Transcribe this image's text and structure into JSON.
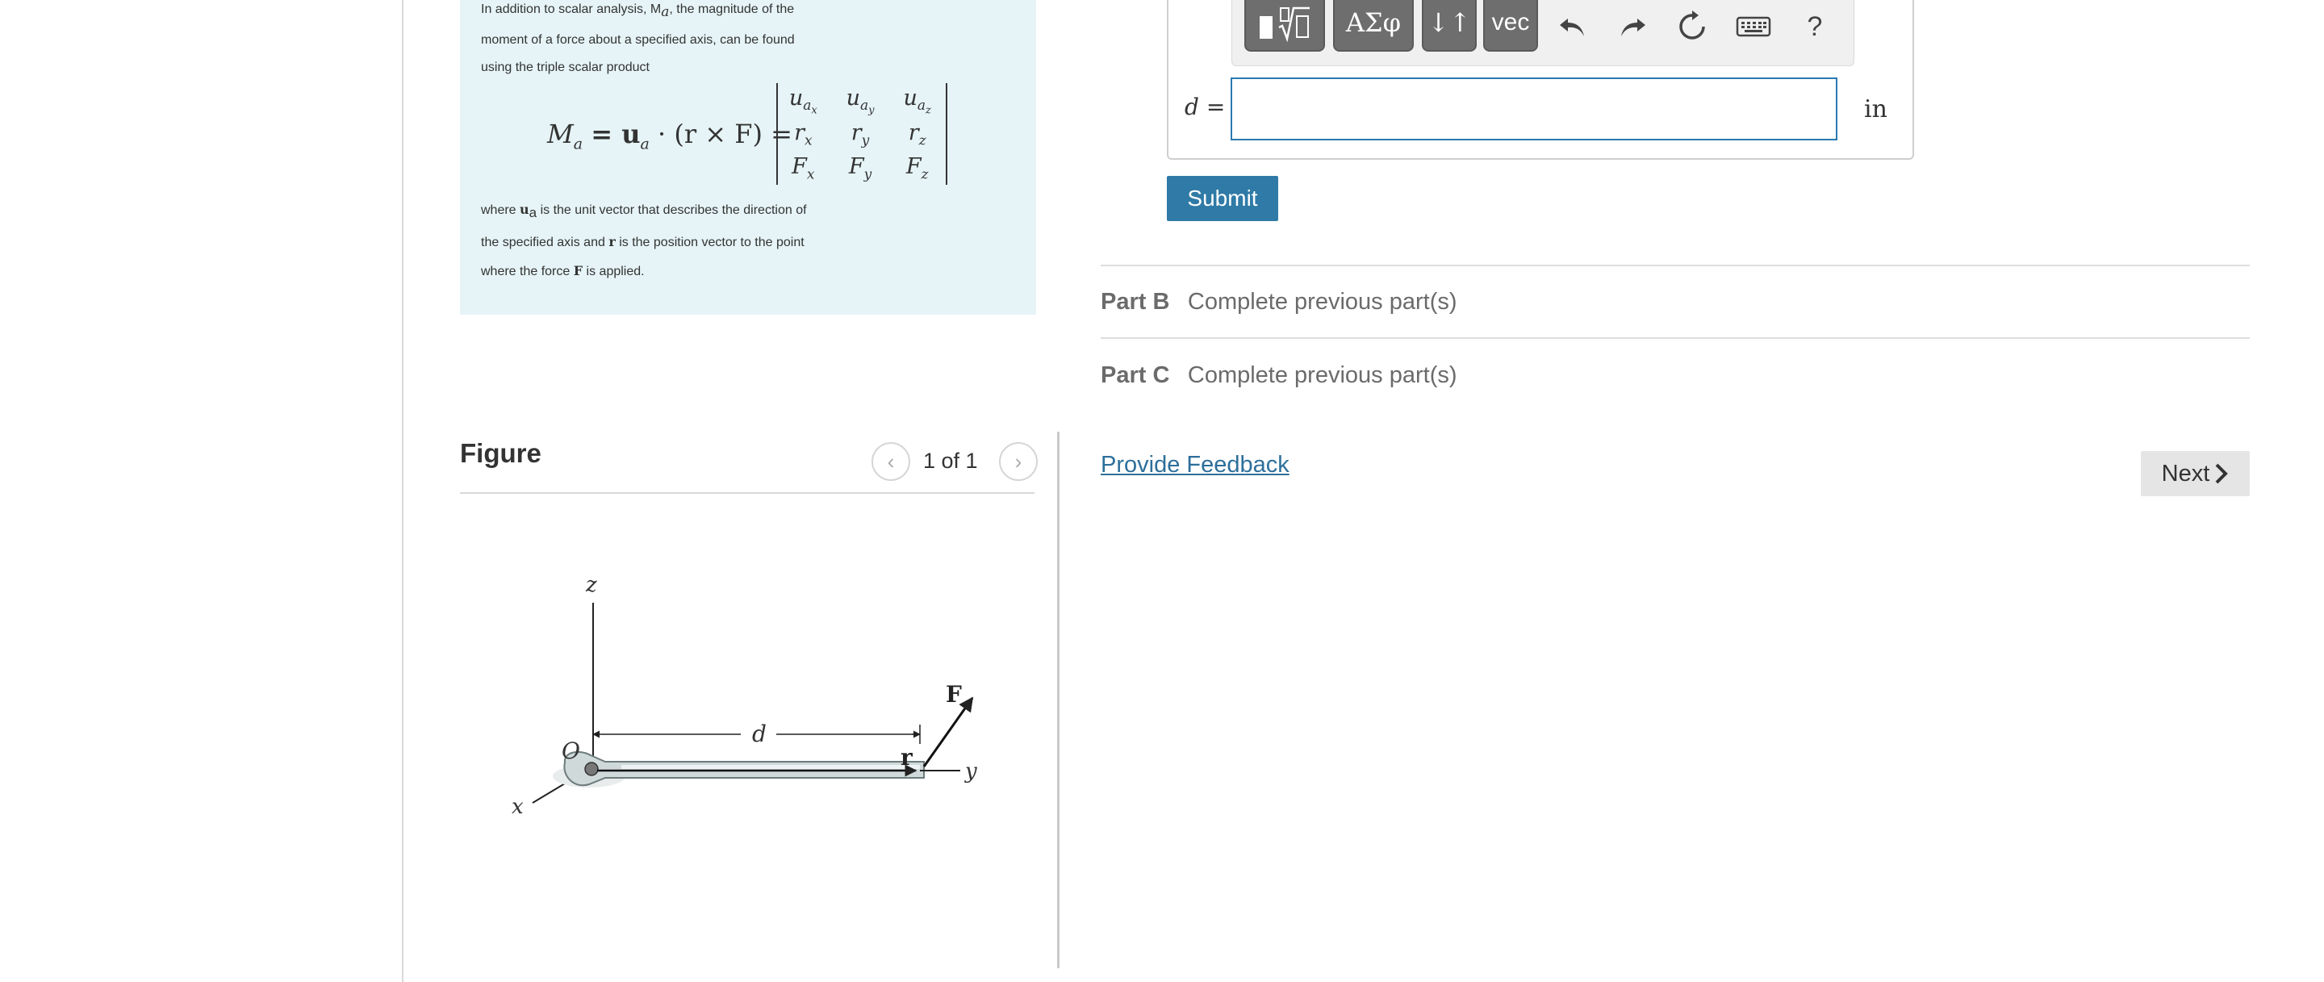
{
  "info": {
    "intro_line1": "In addition to scalar analysis, M",
    "intro_line1_sub": "a",
    "intro_line1_end": ", the magnitude of the",
    "intro_line2": "moment of a force about a specified axis, can be found",
    "intro_line3": "using the triple scalar product",
    "formula": {
      "lhs": "M",
      "lhs_sub": "a",
      "rhs": "= u",
      "rhs_sub": "a",
      "tail": " · (r × F) =",
      "matrix": [
        [
          {
            "v": "u",
            "s": "a",
            "ss": "x"
          },
          {
            "v": "u",
            "s": "a",
            "ss": "y"
          },
          {
            "v": "u",
            "s": "a",
            "ss": "z"
          }
        ],
        [
          {
            "v": "r",
            "s": "x",
            "ss": ""
          },
          {
            "v": "r",
            "s": "y",
            "ss": ""
          },
          {
            "v": "r",
            "s": "z",
            "ss": ""
          }
        ],
        [
          {
            "v": "F",
            "s": "x",
            "ss": ""
          },
          {
            "v": "F",
            "s": "y",
            "ss": ""
          },
          {
            "v": "F",
            "s": "z",
            "ss": ""
          }
        ]
      ]
    },
    "where1": "where ",
    "where_ua": "u",
    "where_ua_sub": "a",
    "where2": " is the unit vector that describes the direction of",
    "where3": "the specified axis and ",
    "where_r": "r",
    "where4": " is the position vector to the point",
    "where5": "where the force ",
    "where_F": "F",
    "where6": " is applied."
  },
  "figure": {
    "title": "Figure",
    "prev_icon": "chevron-left-icon",
    "next_icon": "chevron-right-icon",
    "count": "1 of 1",
    "labels": {
      "z": "z",
      "x": "x",
      "y": "y",
      "O": "O",
      "d": "d",
      "r": "r",
      "F": "F"
    }
  },
  "answer": {
    "toolbar": {
      "templates_icon": "templates-icon",
      "greek": "ΑΣφ",
      "updown": "↓↑",
      "vec": "vec",
      "undo_icon": "undo-icon",
      "redo_icon": "redo-icon",
      "reset_icon": "reset-icon",
      "keyboard_icon": "keyboard-icon",
      "help": "?"
    },
    "d_label": "d =",
    "d_value": "",
    "unit": "in",
    "submit": "Submit"
  },
  "parts": [
    {
      "label": "Part B",
      "text": "Complete previous part(s)"
    },
    {
      "label": "Part C",
      "text": "Complete previous part(s)"
    }
  ],
  "feedback": "Provide Feedback",
  "next": "Next",
  "colors": {
    "accent": "#2f7aa6",
    "info_bg": "#e6f4f7",
    "input_border": "#2a7ab0",
    "link": "#2d6f9b"
  }
}
